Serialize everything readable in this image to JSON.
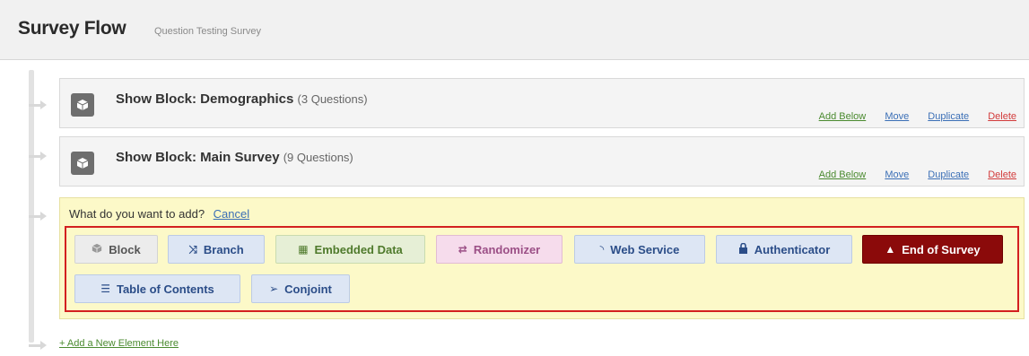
{
  "header": {
    "title": "Survey Flow",
    "subtitle": "Question Testing Survey"
  },
  "blocks": [
    {
      "title": "Show Block: Demographics",
      "count": "(3 Questions)",
      "actions": {
        "add_below": "Add Below",
        "move": "Move",
        "duplicate": "Duplicate",
        "delete": "Delete"
      }
    },
    {
      "title": "Show Block: Main Survey",
      "count": "(9 Questions)",
      "actions": {
        "add_below": "Add Below",
        "move": "Move",
        "duplicate": "Duplicate",
        "delete": "Delete"
      }
    }
  ],
  "add_panel": {
    "question": "What do you want to add?",
    "cancel": "Cancel",
    "options": [
      {
        "label": "Block",
        "icon": "cube-icon"
      },
      {
        "label": "Branch",
        "icon": "branch-icon"
      },
      {
        "label": "Embedded Data",
        "icon": "table-icon"
      },
      {
        "label": "Randomizer",
        "icon": "shuffle-icon"
      },
      {
        "label": "Web Service",
        "icon": "signal-icon"
      },
      {
        "label": "Authenticator",
        "icon": "lock-icon"
      },
      {
        "label": "End of Survey",
        "icon": "warning-icon"
      },
      {
        "label": "Table of Contents",
        "icon": "list-icon"
      },
      {
        "label": "Conjoint",
        "icon": "split-arrow-icon"
      }
    ]
  },
  "add_new_element": "+ Add a New Element Here",
  "colors": {
    "end_of_survey": "#8b0a0a",
    "highlight_border": "#d32020",
    "panel_bg": "#fcf9c8"
  }
}
